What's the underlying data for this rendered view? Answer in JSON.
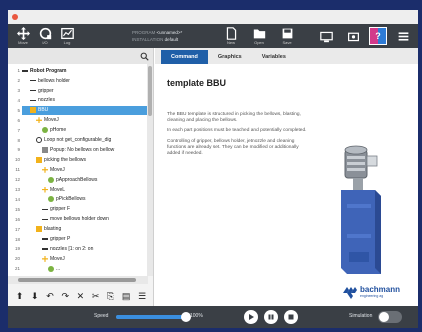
{
  "window": {
    "close_color": "#e9573f"
  },
  "topbar": {
    "buttons": [
      {
        "label": "Move",
        "icon": "move-cross-icon"
      },
      {
        "label": "I/O",
        "icon": "io-icon"
      },
      {
        "label": "Log",
        "icon": "log-icon"
      }
    ],
    "program_label": "PROGRAM",
    "program_value": "<unnamed>*",
    "installation_label": "INSTALLATION",
    "installation_value": "default",
    "file_buttons": [
      {
        "label": "New",
        "icon": "new-file-icon"
      },
      {
        "label": "Open",
        "icon": "open-folder-icon"
      },
      {
        "label": "Save",
        "icon": "save-icon"
      }
    ],
    "mode_badge": "?"
  },
  "tree": {
    "rows": [
      {
        "num": "1",
        "text": "Robot Program",
        "icon": "expand-icon",
        "bold": true
      },
      {
        "num": "2",
        "text": "bellows holder",
        "icon": "line-icon"
      },
      {
        "num": "3",
        "text": "gripper",
        "icon": "line-icon"
      },
      {
        "num": "4",
        "text": "nozzles",
        "icon": "line-icon"
      },
      {
        "num": "5",
        "text": "BBU",
        "icon": "folder-icon",
        "selected": true
      },
      {
        "num": "6",
        "text": "MoveJ",
        "icon": "move-icon"
      },
      {
        "num": "7",
        "text": "pHome",
        "icon": "waypoint-icon"
      },
      {
        "num": "8",
        "text": "Loop not get_configurable_dig",
        "icon": "loop-icon"
      },
      {
        "num": "9",
        "text": "Popup: No bellows on bellow",
        "icon": "popup-icon"
      },
      {
        "num": "10",
        "text": "picking the bellows",
        "icon": "folder-icon"
      },
      {
        "num": "11",
        "text": "MoveJ",
        "icon": "move-icon"
      },
      {
        "num": "12",
        "text": "pApproachBellows",
        "icon": "waypoint-icon"
      },
      {
        "num": "13",
        "text": "MoveL",
        "icon": "move-icon"
      },
      {
        "num": "14",
        "text": "pPickBellows",
        "icon": "waypoint-icon"
      },
      {
        "num": "15",
        "text": "gripper F",
        "icon": "line-icon"
      },
      {
        "num": "16",
        "text": "move bellows holder down",
        "icon": "line-icon"
      },
      {
        "num": "17",
        "text": "blasting",
        "icon": "folder-icon"
      },
      {
        "num": "18",
        "text": "gripper P",
        "icon": "line-icon"
      },
      {
        "num": "19",
        "text": "nozzles [1: on 2: on",
        "icon": "line-icon"
      },
      {
        "num": "20",
        "text": "MoveJ",
        "icon": "move-icon"
      },
      {
        "num": "21",
        "text": "...",
        "icon": "waypoint-icon"
      }
    ]
  },
  "edit_toolbar": [
    "⬆",
    "⬇",
    "↶",
    "↷",
    "✕",
    "✂",
    "⎘",
    "▤",
    "☰"
  ],
  "tabs": [
    {
      "label": "Command",
      "active": true
    },
    {
      "label": "Graphics",
      "active": false
    },
    {
      "label": "Variables",
      "active": false
    }
  ],
  "content": {
    "title": "template BBU",
    "paragraphs": [
      "The BBU template is structured in picking the bellows, blasting, cleaning and placing the bellows.",
      "In each part positions must be teached and potentially completed.",
      "Controlling of gripper, bellows holder, jetnozzle and cleaning functions are already set. They can be modified or additionally added if needed."
    ]
  },
  "brand": {
    "name": "bachmann",
    "sub": "engineering ag",
    "color": "#1f4f9e"
  },
  "footer": {
    "speed_label": "Speed",
    "speed_value": "100%",
    "speed_fraction": 1.0,
    "simulation_label": "Simulation",
    "simulation_on": false
  },
  "colors": {
    "accent": "#1f5fa8",
    "selection": "#4a9edd",
    "bar": "#3a3f45",
    "frame": "#1b2d6b"
  }
}
